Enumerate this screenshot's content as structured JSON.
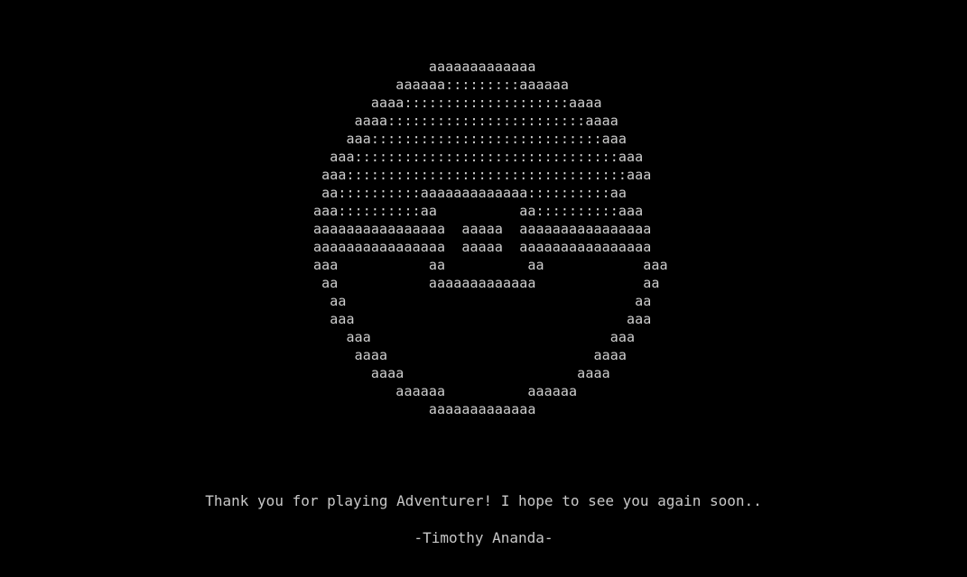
{
  "art": {
    "lines": [
      "              aaaaaaaaaaaaa",
      "          aaaaaa:::::::::aaaaaa",
      "       aaaa::::::::::::::::::::aaaa",
      "     aaaa::::::::::::::::::::::::aaaa",
      "    aaa::::::::::::::::::::::::::::aaa",
      "  aaa::::::::::::::::::::::::::::::::aaa",
      " aaa::::::::::::::::::::::::::::::::::aaa",
      " aa::::::::::aaaaaaaaaaaaa::::::::::aa",
      "aaa::::::::::aa          aa::::::::::aaa",
      "aaaaaaaaaaaaaaaa  aaaaa  aaaaaaaaaaaaaaaa",
      "aaaaaaaaaaaaaaaa  aaaaa  aaaaaaaaaaaaaaaa",
      "aaa           aa          aa            aaa",
      " aa           aaaaaaaaaaaaa             aa",
      "  aa                                   aa",
      "  aaa                                 aaa",
      "    aaa                             aaa",
      "     aaaa                         aaaa",
      "       aaaa                     aaaa",
      "          aaaaaa          aaaaaa",
      "              aaaaaaaaaaaaa"
    ]
  },
  "message": "Thank you for playing Adventurer! I hope to see you again soon..",
  "signature": "-Timothy Ananda-",
  "colors": {
    "background": "#000000",
    "text": "#c8c8c8"
  }
}
